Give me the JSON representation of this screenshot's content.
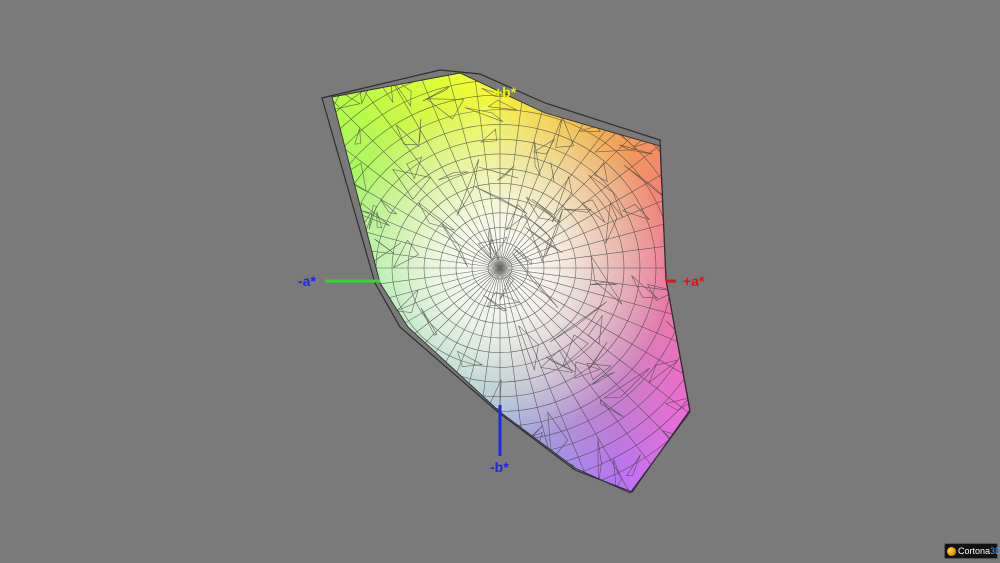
{
  "axes": {
    "plus_b": "+b*",
    "minus_a": "-a*",
    "plus_a": "+a*",
    "minus_b": "-b*"
  },
  "axis_colors": {
    "plus_b": "#f0f000",
    "minus_a": "#2ed82e",
    "plus_a": "#e01515",
    "minus_b": "#1a2adf"
  },
  "branding": {
    "name": "Cortona",
    "suffix": "3D",
    "icon": "cortona-logo-icon"
  },
  "background_color": "#7a7a7a",
  "mesh_color": "#3a3a3a"
}
